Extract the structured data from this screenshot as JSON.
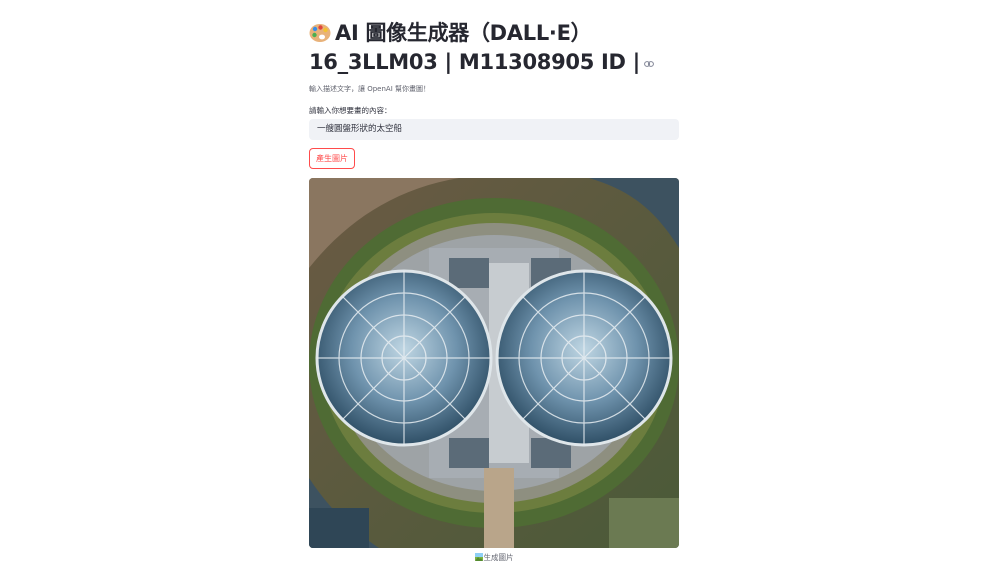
{
  "header": {
    "title_line1": "AI 圖像生成器（DALL·E）",
    "title_line2": "16_3LLM03 | M11308905 ID |",
    "title_icon": "palette-icon",
    "anchor_icon": "link-icon"
  },
  "caption": "輸入描述文字，讓 OpenAI 幫你畫圖！",
  "prompt_input": {
    "label": "請輸入你想要畫的內容：",
    "value": "一艘圓盤形狀的太空船"
  },
  "generate_button": {
    "label": "產生圖片",
    "accent": "#ff4b4b"
  },
  "generated_image": {
    "caption": "生成圖片",
    "caption_icon": "picture-icon"
  }
}
